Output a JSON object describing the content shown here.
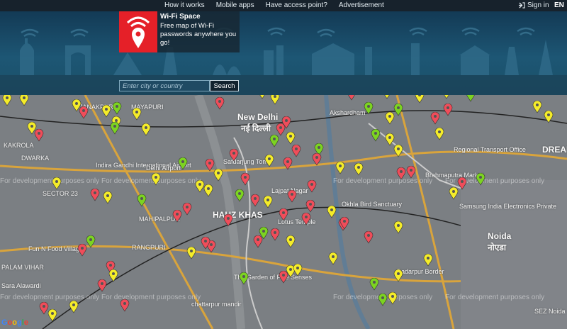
{
  "nav": {
    "items": [
      "How it works",
      "Mobile apps",
      "Have access point?",
      "Advertisement"
    ],
    "signin": "Sign in",
    "lang": "EN"
  },
  "brand": {
    "name": "Wi-Fi Space",
    "tagline": "Free map of Wi-Fi passwords anywhere you go!"
  },
  "search": {
    "placeholder": "Enter city or country",
    "button": "Search"
  },
  "map": {
    "watermark": "For development purposes only",
    "attribution": "Google",
    "places": [
      "JANAKPURI",
      "MAYAPURI",
      "KAKROLA",
      "Indira Gandhi International Airport",
      "Delhi Airport",
      "New Delhi",
      "नई दिल्ली",
      "Akshardham",
      "Safdarjung Tomb",
      "HAUZ KHAS",
      "Okhla Bird Sanctuary",
      "RANGPURI",
      "Fun N Food Village",
      "The Garden of Five Senses",
      "Noida",
      "नोएडा",
      "Brahmaputra Market",
      "Regional Transport Office",
      "Samsung India Electronics Private",
      "Badarpur Border",
      "SECTOR 23",
      "DWARKA",
      "PALAM VIHAR",
      "Sara Alawardi",
      "chattarpur mandir",
      "MAHIPALPUR",
      "Lotus Temple",
      "SEZ Noida",
      "DREAM",
      "Lajpat Nagar"
    ],
    "pin_colors": {
      "red": "#ef4d5a",
      "yellow": "#f4ec2a",
      "green": "#7cd321"
    }
  }
}
